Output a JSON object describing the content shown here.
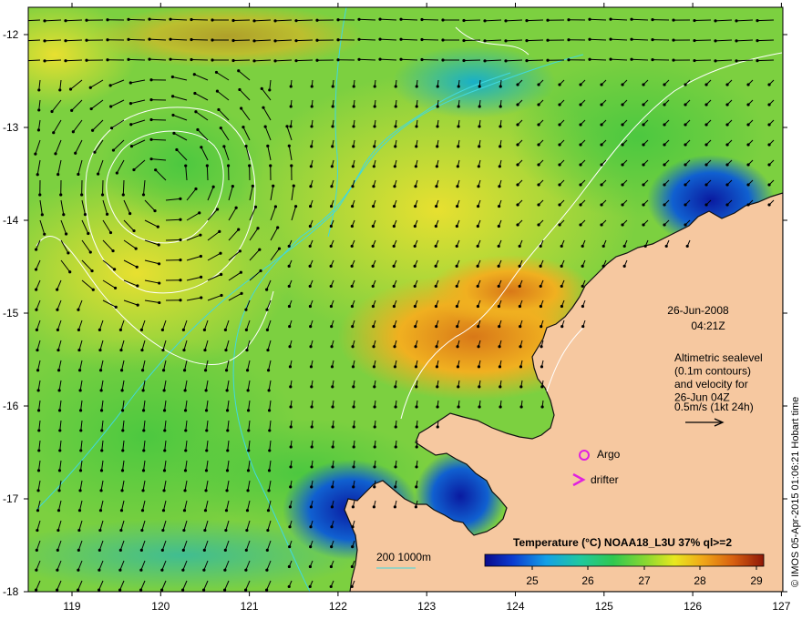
{
  "map": {
    "lon_ticks": [
      "119",
      "120",
      "121",
      "122",
      "123",
      "124",
      "125",
      "126",
      "127"
    ],
    "lat_ticks": [
      "-12",
      "-13",
      "-14",
      "-15",
      "-16",
      "-17",
      "-18"
    ],
    "lon_range": [
      118.6,
      127.0
    ],
    "lat_range": [
      -12.0,
      -18.0
    ]
  },
  "annotation": {
    "date": "26-Jun-2008",
    "time": "04:21Z",
    "altimetry_lines": [
      "Altimetric sealevel",
      "(0.1m contours)",
      "and velocity for",
      "26-Jun 04Z"
    ],
    "velocity_scale": "0.5m/s (1kt 24h)"
  },
  "markers": {
    "argo_label": "Argo",
    "drifter_label": "drifter"
  },
  "bathymetry": {
    "label": "200  1000m"
  },
  "legend": {
    "title": "Temperature (°C) NOAA18_L3U 37% ql>=2",
    "ticks": [
      "25",
      "26",
      "27",
      "28",
      "29"
    ]
  },
  "credit": "© IMOS 05-Apr-2015 01:06:21 Hobart time",
  "colors": {
    "land": "#f6c8a0",
    "contour": "#ffffff",
    "bathy": "#40d8e0",
    "marker": "#e020e0"
  }
}
